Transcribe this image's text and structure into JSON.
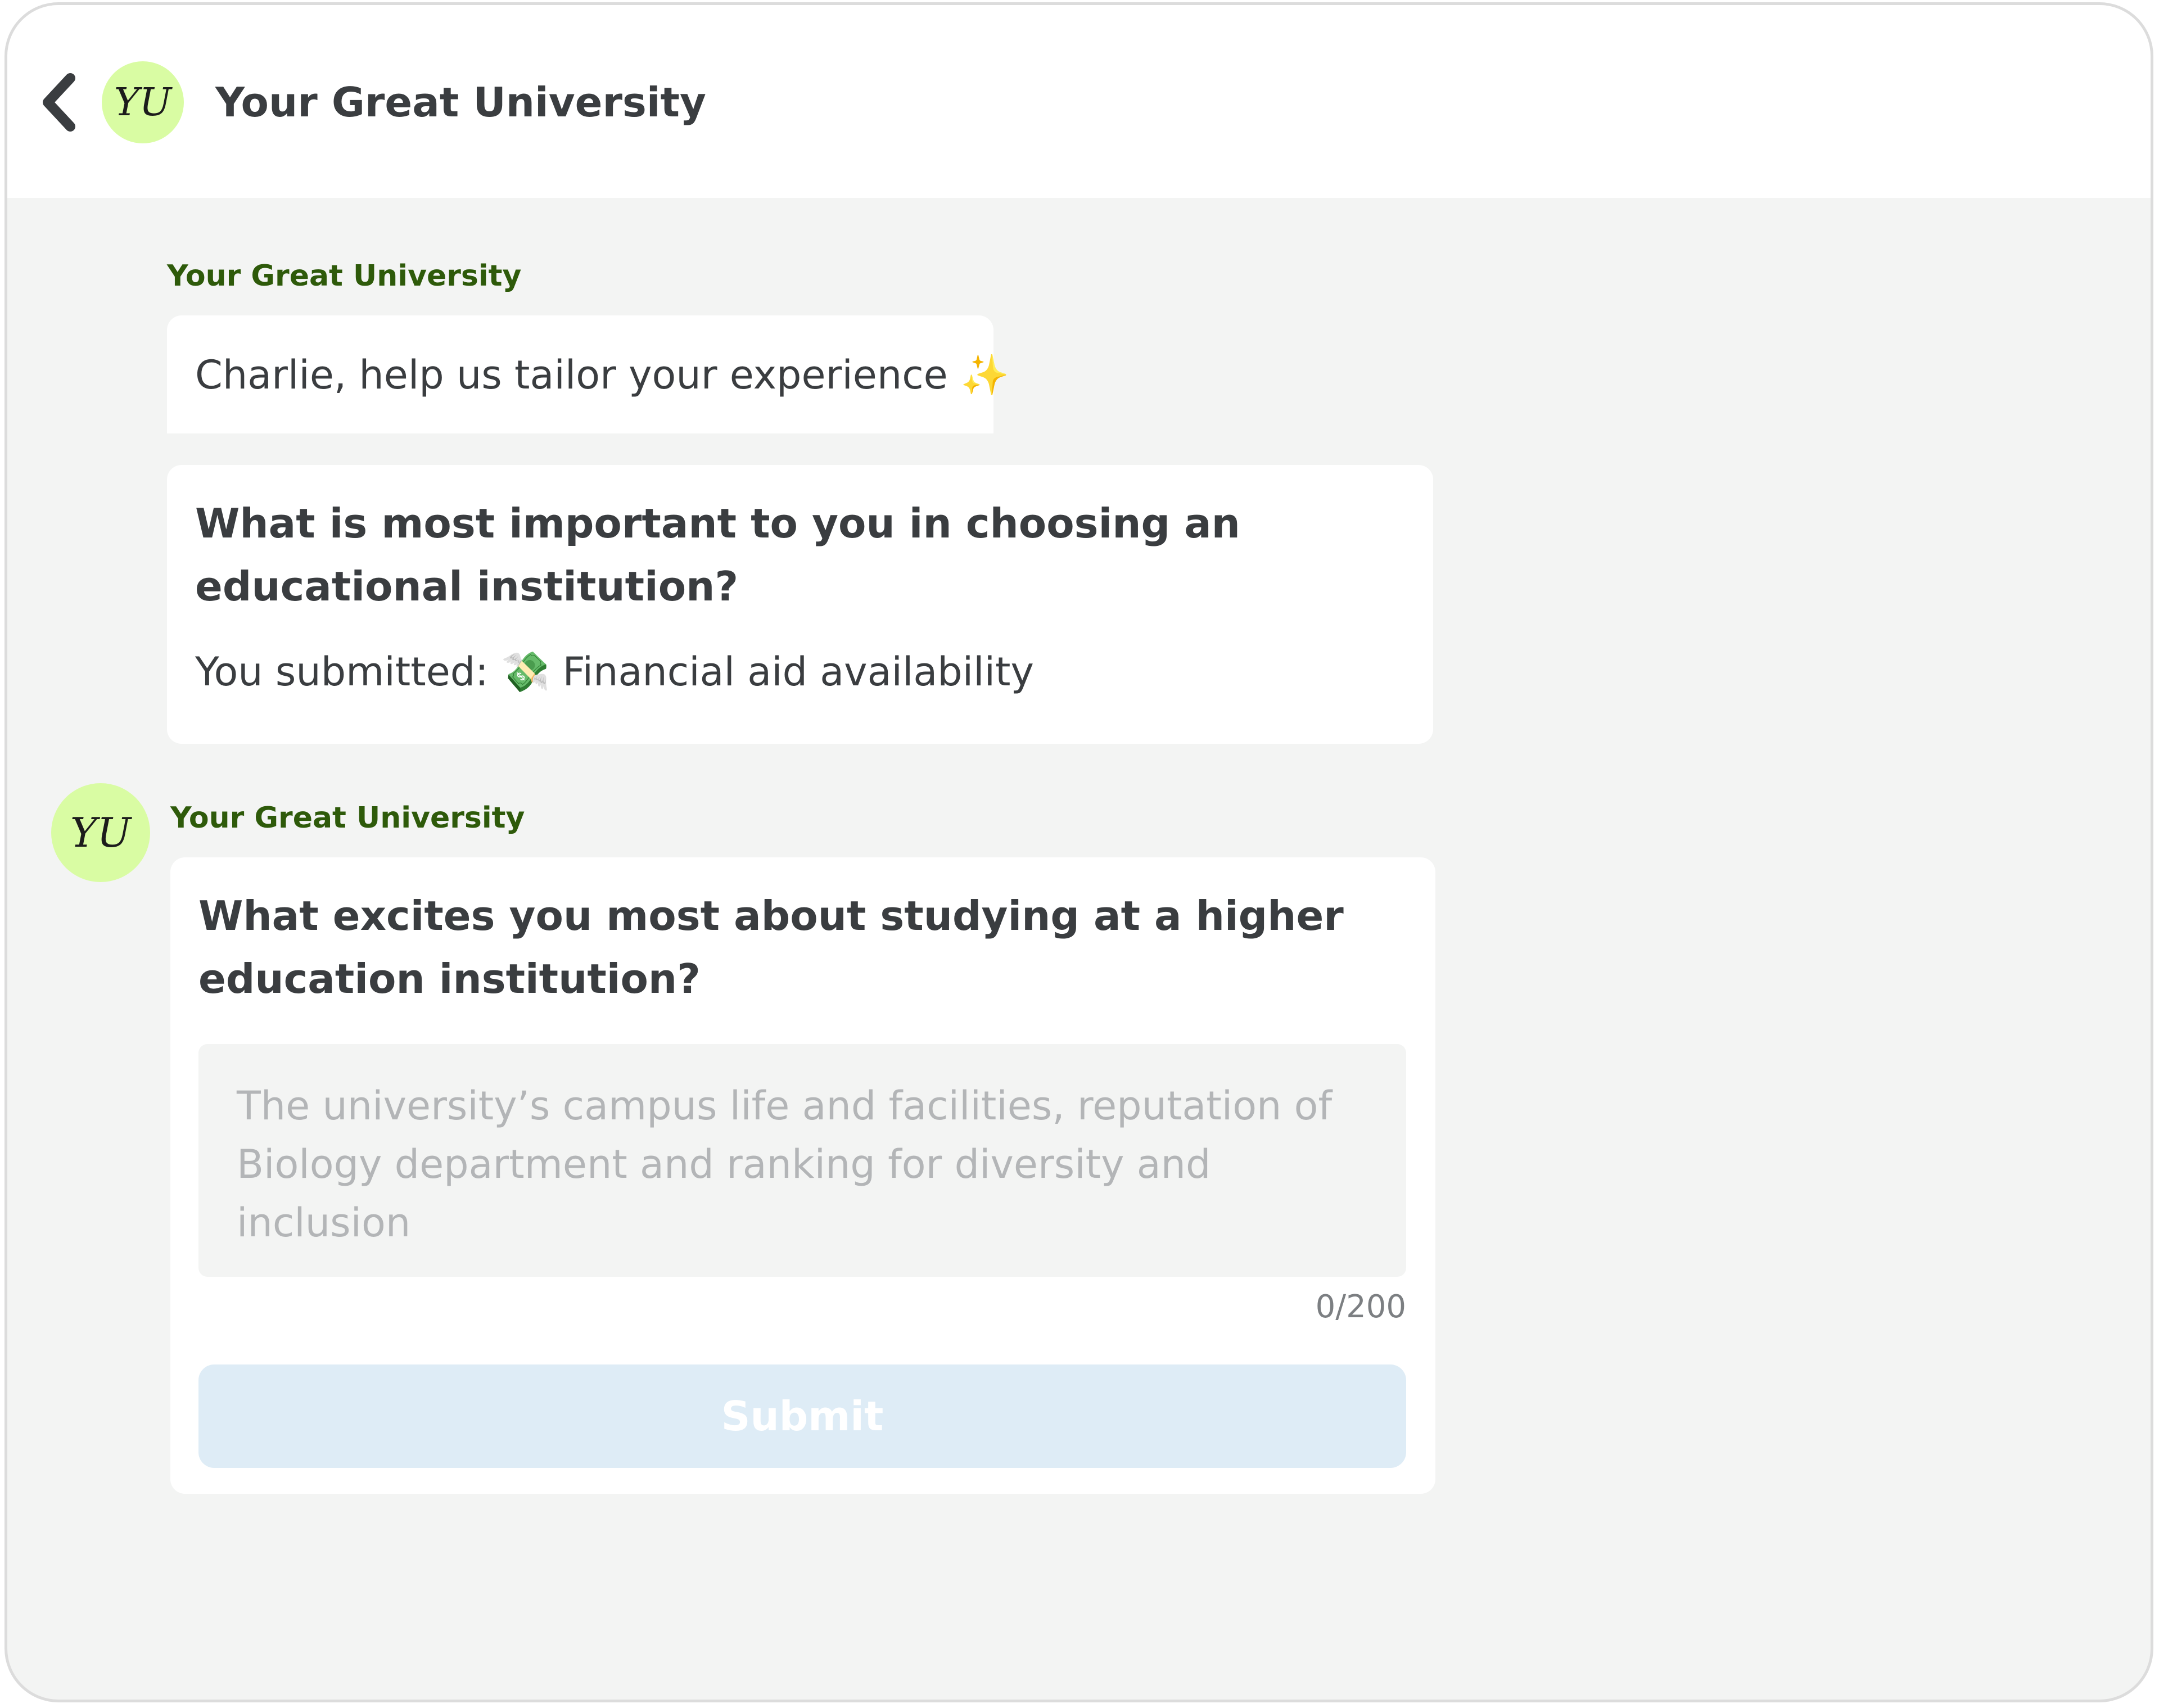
{
  "header": {
    "avatar_initials": "YU",
    "title": "Your Great University"
  },
  "messages": {
    "first": {
      "sender": "Your Great University",
      "greeting": "Charlie, help us tailor your experience ✨",
      "question": "What is most important to you in choosing an educational institution?",
      "submitted_prefix": "You submitted: ",
      "submitted_icon": "💸",
      "submitted_value": " Financial aid availability"
    },
    "second": {
      "avatar_initials": "YU",
      "sender": "Your Great University",
      "question": "What excites you most about studying at a higher education institution?",
      "input_placeholder": "The university’s campus life and facilities, reputation of Biology department and ranking for diversity and inclusion",
      "input_value": "",
      "char_counter": "0/200",
      "submit_label": "Submit"
    }
  },
  "colors": {
    "avatar_bg": "#d9fca3",
    "sender_text": "#2e5a0a",
    "chat_bg": "#f3f4f3",
    "submit_disabled_bg": "#deecf6"
  }
}
